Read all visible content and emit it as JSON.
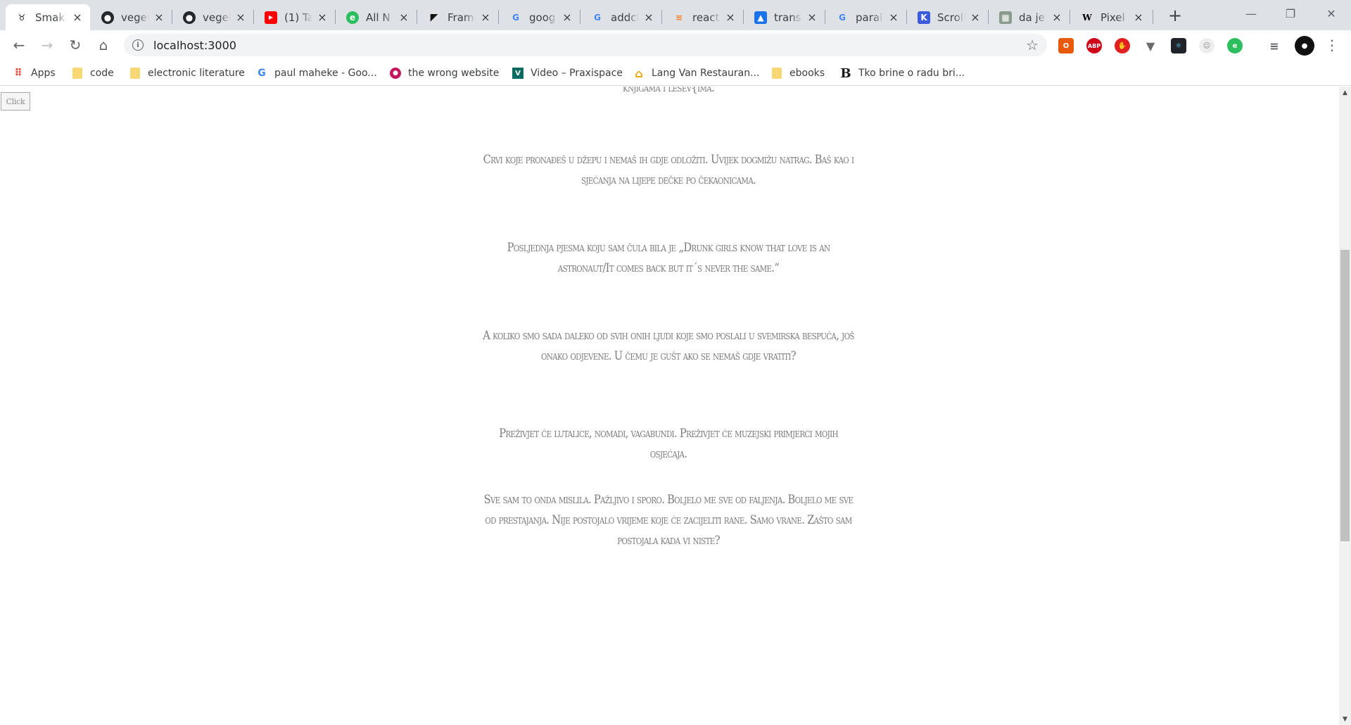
{
  "browser": {
    "tabs": [
      {
        "label": "Smak",
        "icon": "bull-icon",
        "active": true
      },
      {
        "label": "vegel",
        "icon": "github-icon"
      },
      {
        "label": "vegel",
        "icon": "github-icon"
      },
      {
        "label": "(1) Ta",
        "icon": "youtube-icon"
      },
      {
        "label": "All N",
        "icon": "evernote-icon"
      },
      {
        "label": "Frame",
        "icon": "framer-icon"
      },
      {
        "label": "goog",
        "icon": "google-icon"
      },
      {
        "label": "addcl",
        "icon": "google-icon"
      },
      {
        "label": "react",
        "icon": "stackoverflow-icon"
      },
      {
        "label": "transl",
        "icon": "translate-icon"
      },
      {
        "label": "parall",
        "icon": "google-icon"
      },
      {
        "label": "Scroll",
        "icon": "scroll-icon"
      },
      {
        "label": "da je",
        "icon": "image-icon"
      },
      {
        "label": "Pixel",
        "icon": "wikipedia-icon"
      }
    ],
    "new_tab": "+",
    "window_controls": {
      "minimize": "—",
      "restore": "❐",
      "close": "✕"
    },
    "toolbar": {
      "back": "←",
      "forward": "→",
      "reload": "↻",
      "home": "⌂",
      "info": "i",
      "url": "localhost:3000",
      "star": "☆",
      "menu": "⋮"
    },
    "bookmarks": [
      {
        "label": "Apps",
        "icon": "apps-grid-icon"
      },
      {
        "label": "code",
        "icon": "folder-icon"
      },
      {
        "label": "electronic literature",
        "icon": "folder-icon"
      },
      {
        "label": "paul maheke - Goo...",
        "icon": "google-icon"
      },
      {
        "label": "the wrong website",
        "icon": "wrong-website-icon"
      },
      {
        "label": "Video – Praxispace",
        "icon": "praxispace-icon"
      },
      {
        "label": "Lang Van Restauran...",
        "icon": "restaurant-icon"
      },
      {
        "label": "ebooks",
        "icon": "folder-icon"
      },
      {
        "label": "Tko brine o radu bri...",
        "icon": "b-icon"
      }
    ]
  },
  "page": {
    "button_label": "Click",
    "paragraphs": [
      "knjigama i lešev{ima.",
      "Crvi koje pronađeš u džepu i nemaš ih gdje odložiti. Uvijek dogmižu natrag. Baš kao i sjećanja na lijepe dečke po čekaonicama.",
      "Posljednja pjesma koju sam čula bila je „Drunk girls know that love is an astronaut/It comes back but it´s never the same.“",
      "A koliko smo sada daleko od svih onih ljudi koje smo poslali u svemirska bespuća, još onako odjevene. U čemu je gušt ako se nemaš gdje vratiti?",
      "Preživjet će lutalice, nomadi, vagabundi. Preživjet će muzejski primjerci mojih osjećaja.",
      "Sve sam to onda mislila. Pažljivo i sporo. Boljelo me sve od faljenja. Boljelo me sve od prestajanja. Nije postojalo vrijeme koje će zacijeliti rane. Samo vrane. Zašto sam postojala kada vi niste?"
    ]
  }
}
